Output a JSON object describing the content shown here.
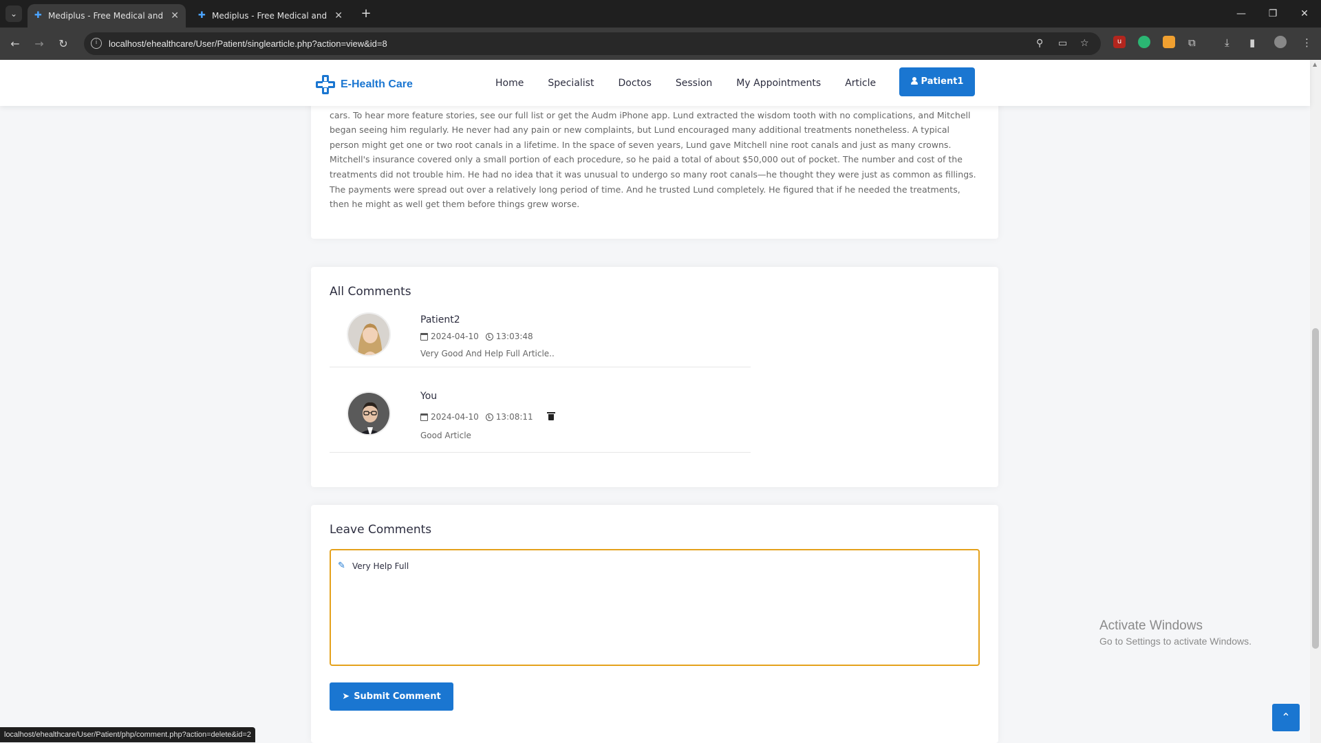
{
  "browser": {
    "tabs": [
      {
        "title": "Mediplus - Free Medical and Do",
        "active": true
      },
      {
        "title": "Mediplus - Free Medical and Do",
        "active": false
      }
    ],
    "url": "localhost/ehealthcare/User/Patient/singlearticle.php?action=view&id=8",
    "status_url": "localhost/ehealthcare/User/Patient/php/comment.php?action=delete&id=2"
  },
  "header": {
    "logo_text": "E-Health Care",
    "nav": [
      "Home",
      "Specialist",
      "Doctos",
      "Session",
      "My Appointments",
      "Article"
    ],
    "user_button": "Patient1"
  },
  "article": {
    "body": "was charming, chatty, and upbeat. At the time, Mitchell and Lund both owned Chevrolet Chevelles, and they bonded over their mutual love of classic cars. To hear more feature stories, see our full list or get the Audm iPhone app. Lund extracted the wisdom tooth with no complications, and Mitchell began seeing him regularly. He never had any pain or new complaints, but Lund encouraged many additional treatments nonetheless. A typical person might get one or two root canals in a lifetime. In the space of seven years, Lund gave Mitchell nine root canals and just as many crowns. Mitchell's insurance covered only a small portion of each procedure, so he paid a total of about $50,000 out of pocket. The number and cost of the treatments did not trouble him. He had no idea that it was unusual to undergo so many root canals—he thought they were just as common as fillings. The payments were spread out over a relatively long period of time. And he trusted Lund completely. He figured that if he needed the treatments, then he might as well get them before things grew worse."
  },
  "comments": {
    "title": "All Comments",
    "items": [
      {
        "name": "Patient2",
        "date": "2024-04-10",
        "time": "13:03:48",
        "text": "Very Good And Help Full Article..",
        "deletable": false
      },
      {
        "name": "You",
        "date": "2024-04-10",
        "time": "13:08:11",
        "text": "Good Article",
        "deletable": true
      }
    ]
  },
  "leave_comment": {
    "title": "Leave Comments",
    "value": "Very Help Full",
    "submit_label": "Submit Comment"
  },
  "watermark": {
    "line1": "Activate Windows",
    "line2": "Go to Settings to activate Windows."
  },
  "colors": {
    "primary": "#1a76d1",
    "input_focus_border": "#e4a11b"
  }
}
